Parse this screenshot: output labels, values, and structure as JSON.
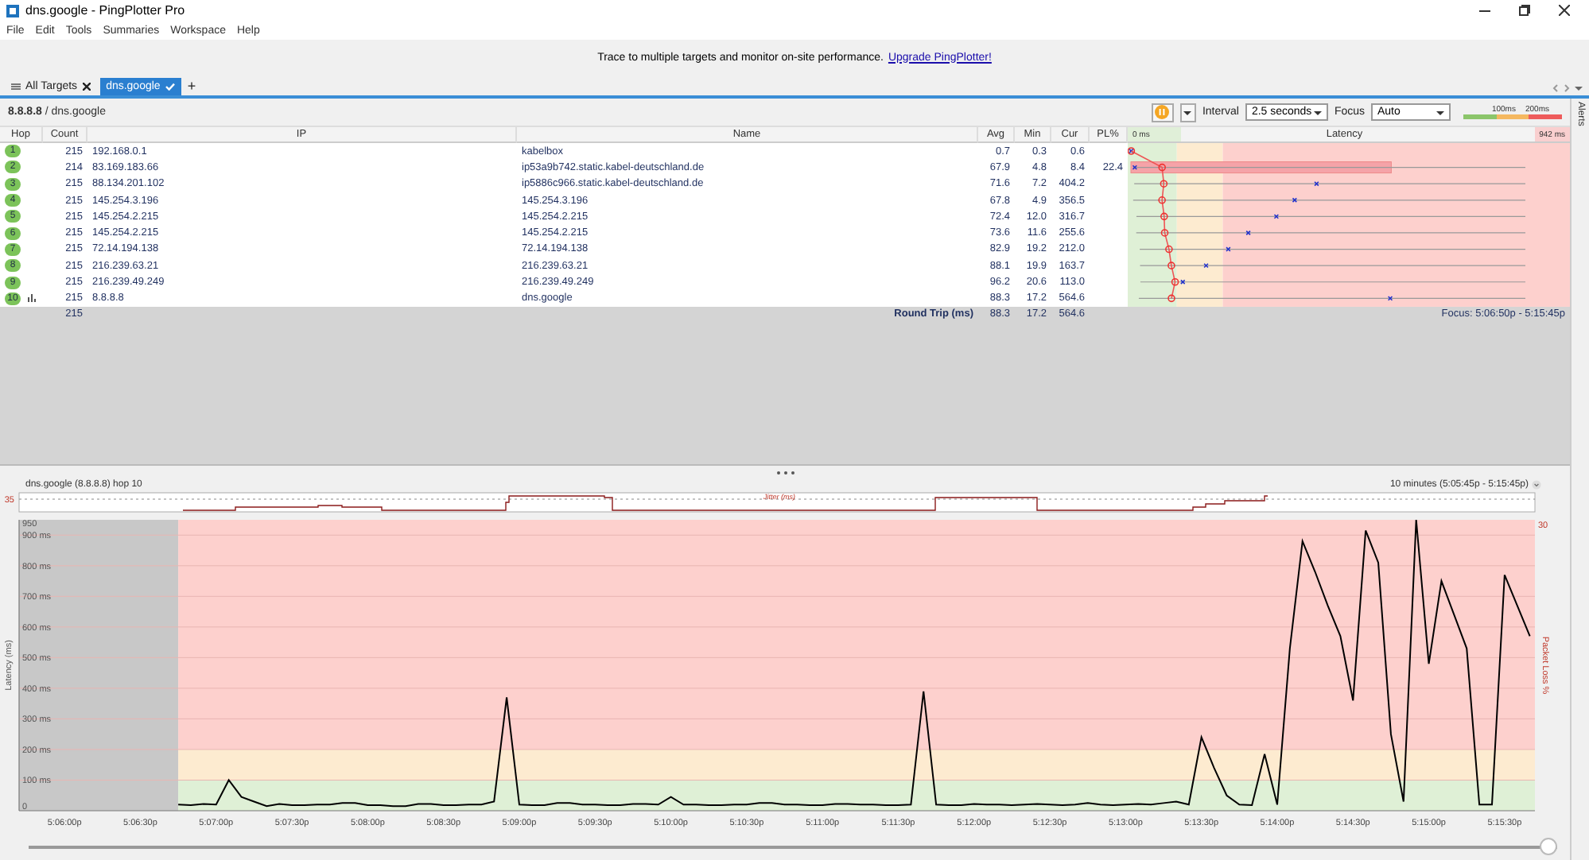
{
  "window": {
    "title": "dns.google - PingPlotter Pro"
  },
  "menu": [
    "File",
    "Edit",
    "Tools",
    "Summaries",
    "Workspace",
    "Help"
  ],
  "banner": {
    "text": "Trace to multiple targets and monitor on-site performance.",
    "link": "Upgrade PingPlotter!"
  },
  "add_tab": "+",
  "tabs": [
    {
      "label": "All Targets",
      "selected": false
    },
    {
      "label": "dns.google",
      "selected": true
    }
  ],
  "toolbar": {
    "target": "8.8.8.8",
    "path": " / dns.google",
    "interval_label": "Interval",
    "interval": "2.5 seconds",
    "focus_label": "Focus",
    "focus": "Auto",
    "legend": [
      "100ms",
      "200ms"
    ]
  },
  "alerts": "Alerts",
  "table": {
    "columns": [
      "Hop",
      "Count",
      "IP",
      "Name",
      "Avg",
      "Min",
      "Cur",
      "PL%"
    ],
    "latency_header": {
      "min": "0 ms",
      "title": "Latency",
      "max": "942 ms"
    },
    "rows": [
      {
        "hop": "1",
        "count": "215",
        "ip": "192.168.0.1",
        "name": "kabelbox",
        "avg": "0.7",
        "min": "0.3",
        "cur": "0.6",
        "pl": "",
        "graphed": false
      },
      {
        "hop": "2",
        "count": "214",
        "ip": "83.169.183.66",
        "name": "ip53a9b742.static.kabel-deutschland.de",
        "avg": "67.9",
        "min": "4.8",
        "cur": "8.4",
        "pl": "22.4",
        "graphed": false
      },
      {
        "hop": "3",
        "count": "215",
        "ip": "88.134.201.102",
        "name": "ip5886c966.static.kabel-deutschland.de",
        "avg": "71.6",
        "min": "7.2",
        "cur": "404.2",
        "pl": "",
        "graphed": false
      },
      {
        "hop": "4",
        "count": "215",
        "ip": "145.254.3.196",
        "name": "145.254.3.196",
        "avg": "67.8",
        "min": "4.9",
        "cur": "356.5",
        "pl": "",
        "graphed": false
      },
      {
        "hop": "5",
        "count": "215",
        "ip": "145.254.2.215",
        "name": "145.254.2.215",
        "avg": "72.4",
        "min": "12.0",
        "cur": "316.7",
        "pl": "",
        "graphed": false
      },
      {
        "hop": "6",
        "count": "215",
        "ip": "145.254.2.215",
        "name": "145.254.2.215",
        "avg": "73.6",
        "min": "11.6",
        "cur": "255.6",
        "pl": "",
        "graphed": false
      },
      {
        "hop": "7",
        "count": "215",
        "ip": "72.14.194.138",
        "name": "72.14.194.138",
        "avg": "82.9",
        "min": "19.2",
        "cur": "212.0",
        "pl": "",
        "graphed": false
      },
      {
        "hop": "8",
        "count": "215",
        "ip": "216.239.63.21",
        "name": "216.239.63.21",
        "avg": "88.1",
        "min": "19.9",
        "cur": "163.7",
        "pl": "",
        "graphed": false
      },
      {
        "hop": "9",
        "count": "215",
        "ip": "216.239.49.249",
        "name": "216.239.49.249",
        "avg": "96.2",
        "min": "20.6",
        "cur": "113.0",
        "pl": "",
        "graphed": false
      },
      {
        "hop": "10",
        "count": "215",
        "ip": "8.8.8.8",
        "name": "dns.google",
        "avg": "88.3",
        "min": "17.2",
        "cur": "564.6",
        "pl": "",
        "graphed": true
      }
    ],
    "total": {
      "count": "215",
      "label": "Round Trip (ms)",
      "avg": "88.3",
      "min": "17.2",
      "cur": "564.6",
      "focus": "Focus: 5:06:50p - 5:15:45p"
    }
  },
  "timeline": {
    "title": "dns.google (8.8.8.8) hop 10",
    "range": "10 minutes (5:05:45p - 5:15:45p)",
    "jitter_max": "35",
    "jitter_label": "Jitter (ms)",
    "loss_max": "30",
    "loss_label": "Packet Loss %",
    "chart_data": {
      "type": "line",
      "ylabel": "Latency (ms)",
      "categories": [
        null,
        null,
        null,
        "5:06:00p",
        null,
        null,
        null,
        null,
        null,
        "5:06:30p",
        null,
        null,
        null,
        null,
        null,
        "5:07:00p",
        null,
        null,
        null,
        null,
        null,
        "5:07:30p",
        null,
        null,
        null,
        null,
        null,
        "5:08:00p",
        null,
        null,
        null,
        null,
        null,
        "5:08:30p",
        null,
        null,
        null,
        null,
        null,
        "5:09:00p",
        null,
        null,
        null,
        null,
        null,
        "5:09:30p",
        null,
        null,
        null,
        null,
        null,
        "5:10:00p",
        null,
        null,
        null,
        null,
        null,
        "5:10:30p",
        null,
        null,
        null,
        null,
        null,
        "5:11:00p",
        null,
        null,
        null,
        null,
        null,
        "5:11:30p",
        null,
        null,
        null,
        null,
        null,
        "5:12:00p",
        null,
        null,
        null,
        null,
        null,
        "5:12:30p",
        null,
        null,
        null,
        null,
        null,
        "5:13:00p",
        null,
        null,
        null,
        null,
        null,
        "5:13:30p",
        null,
        null,
        null,
        null,
        null,
        "5:14:00p",
        null,
        null,
        null,
        null,
        null,
        "5:14:30p",
        null,
        null,
        null,
        null,
        null,
        "5:15:00p",
        null,
        null,
        null,
        null,
        null,
        "5:15:30p",
        null,
        null
      ],
      "ylim": [
        0,
        950
      ],
      "grid": true,
      "yticks": [
        {
          "value": 0,
          "label": "0"
        },
        {
          "value": 100,
          "label": "100 ms"
        },
        {
          "value": 200,
          "label": "200 ms"
        },
        {
          "value": 300,
          "label": "300 ms"
        },
        {
          "value": 400,
          "label": "400 ms"
        },
        {
          "value": 500,
          "label": "500 ms"
        },
        {
          "value": 600,
          "label": "600 ms"
        },
        {
          "value": 700,
          "label": "700 ms"
        },
        {
          "value": 800,
          "label": "800 ms"
        },
        {
          "value": 900,
          "label": "900 ms"
        },
        {
          "value": 950,
          "label": "950"
        }
      ],
      "series": [
        {
          "color": "#000000",
          "values": [
            null,
            null,
            null,
            null,
            null,
            null,
            null,
            null,
            null,
            null,
            null,
            null,
            20,
            18,
            22,
            20,
            100,
            45,
            30,
            15,
            22,
            18,
            18,
            20,
            20,
            25,
            25,
            18,
            18,
            15,
            15,
            22,
            22,
            18,
            18,
            20,
            20,
            30,
            370,
            20,
            18,
            18,
            25,
            25,
            20,
            20,
            18,
            18,
            22,
            22,
            20,
            45,
            20,
            20,
            18,
            18,
            20,
            20,
            25,
            25,
            20,
            20,
            18,
            18,
            22,
            22,
            20,
            20,
            18,
            18,
            20,
            390,
            20,
            18,
            18,
            22,
            20,
            20,
            18,
            20,
            22,
            20,
            18,
            20,
            25,
            20,
            18,
            20,
            22,
            20,
            25,
            30,
            20,
            240,
            140,
            50,
            20,
            18,
            185,
            20,
            530,
            880,
            780,
            670,
            570,
            360,
            915,
            810,
            250,
            30,
            950,
            480,
            750,
            640,
            530,
            20,
            20,
            770,
            670,
            570
          ]
        }
      ]
    }
  }
}
